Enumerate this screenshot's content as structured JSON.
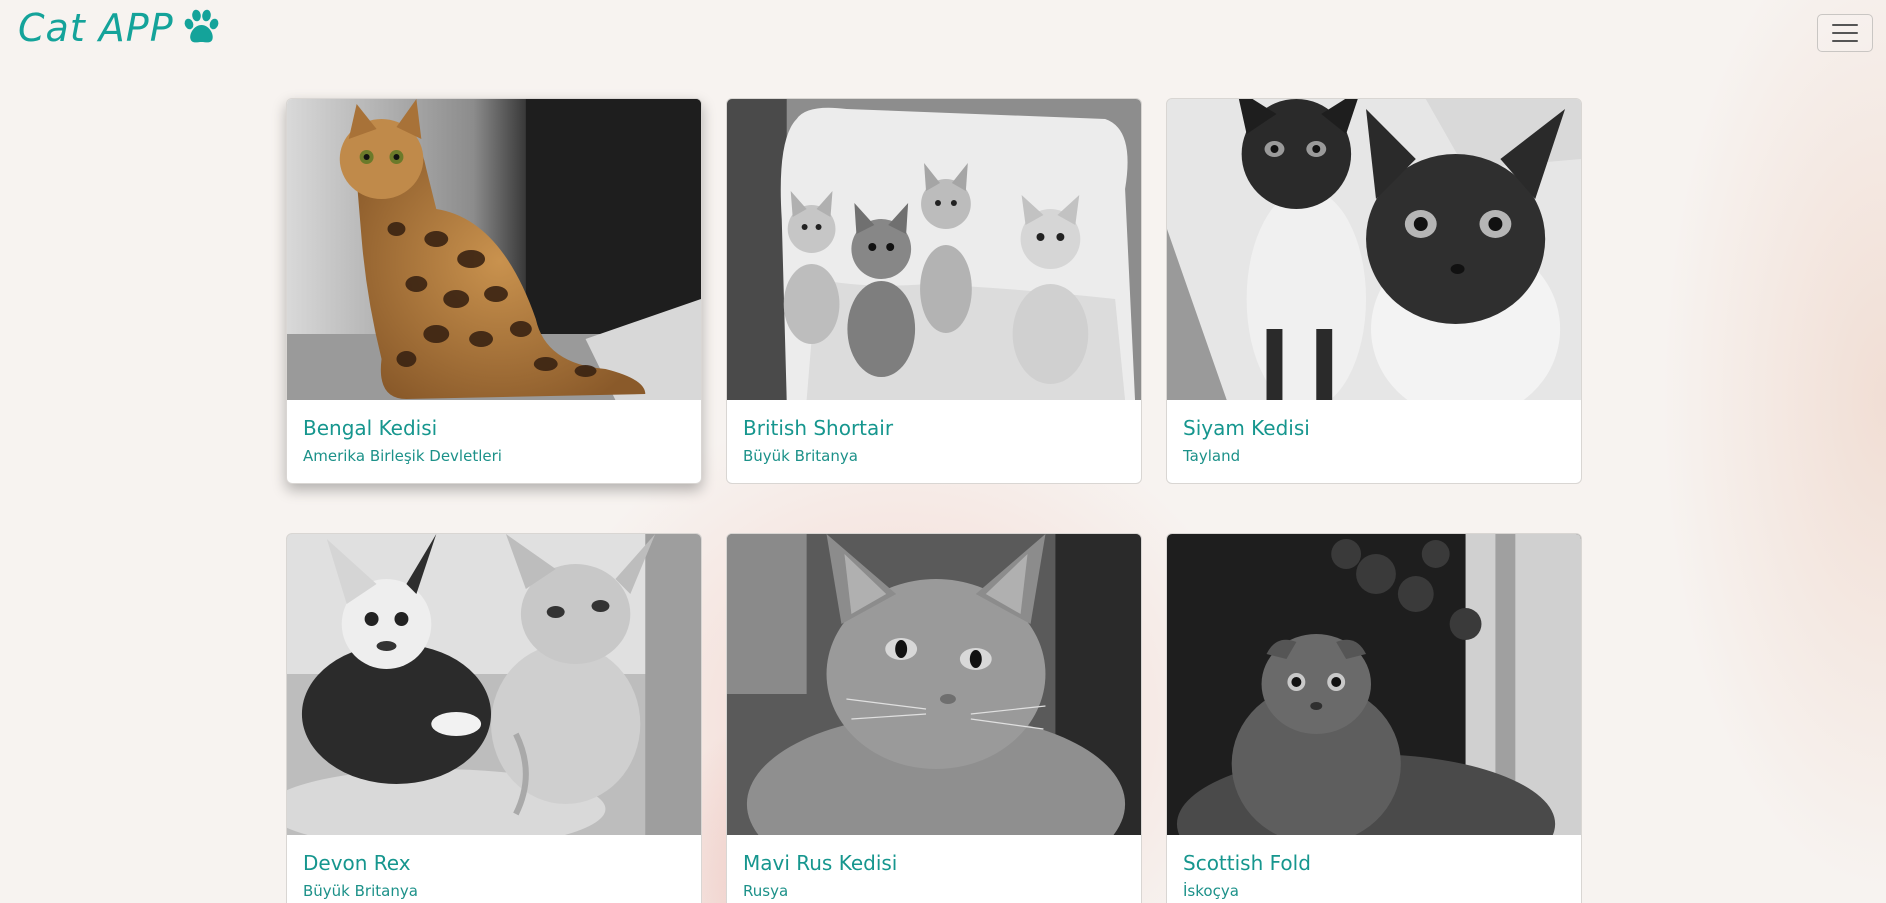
{
  "app": {
    "brand_text": "Cat APP",
    "brand_icon": "paw-icon",
    "menu_icon": "hamburger-menu-icon",
    "accent_color": "#14a39a"
  },
  "cards": [
    {
      "title": "Bengal Kedisi",
      "origin": "Amerika Birleşik Devletleri",
      "image": "bengal-cat-photo"
    },
    {
      "title": "British Shortair",
      "origin": "Büyük Britanya",
      "image": "british-shorthair-kittens-photo"
    },
    {
      "title": "Siyam Kedisi",
      "origin": "Tayland",
      "image": "siamese-cats-photo"
    },
    {
      "title": "Devon Rex",
      "origin": "Büyük Britanya",
      "image": "devon-rex-cats-photo"
    },
    {
      "title": "Mavi Rus Kedisi",
      "origin": "Rusya",
      "image": "russian-blue-cat-photo"
    },
    {
      "title": "Scottish Fold",
      "origin": "İskoçya",
      "image": "scottish-fold-cat-photo"
    }
  ]
}
